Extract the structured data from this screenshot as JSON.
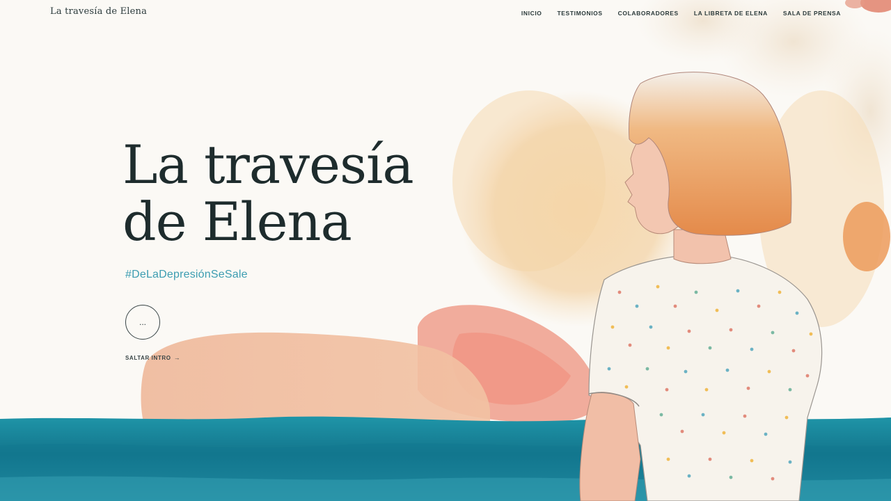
{
  "header": {
    "brand": "La travesía de Elena",
    "nav": [
      {
        "label": "INICIO"
      },
      {
        "label": "TESTIMONIOS"
      },
      {
        "label": "COLABORADORES"
      },
      {
        "label": "LA LIBRETA DE ELENA"
      },
      {
        "label": "SALA DE PRENSA"
      }
    ]
  },
  "hero": {
    "title_line1": "La travesía",
    "title_line2": "de Elena",
    "hashtag": "#DeLaDepresiónSeSale",
    "circle_button_label": "...",
    "skip_label": "SALTAR INTRO",
    "skip_icon": "arrow-right-icon"
  },
  "colors": {
    "background": "#fbf9f5",
    "title": "#1e2c2d",
    "hashtag": "#3c9db1",
    "sea": "#1b8fa0",
    "hair": "#e79a5c"
  }
}
